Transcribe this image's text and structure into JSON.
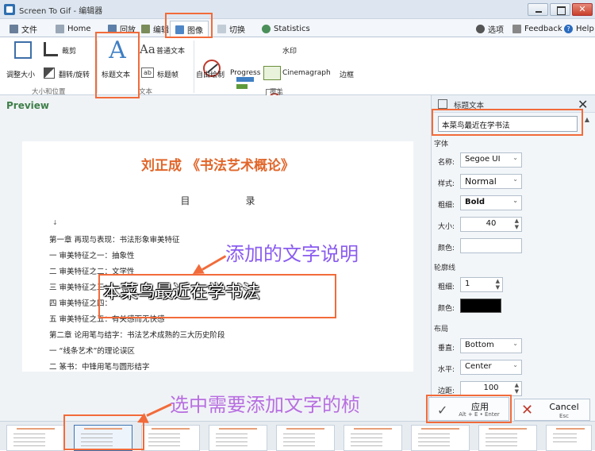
{
  "window": {
    "title": "Screen To Gif - 编辑器"
  },
  "tabs": {
    "file": "文件",
    "home": "Home",
    "playback": "回放",
    "edit": "编辑",
    "image": "图像",
    "transition": "切换",
    "statistics": "Statistics"
  },
  "topright": {
    "settings": "选项",
    "feedback": "Feedback",
    "help": "Help"
  },
  "ribbon": {
    "resize": "调整大小",
    "crop": "裁剪",
    "flip_rotate": "翻转/旋转",
    "group_size_position": "大小和位置",
    "title_text": "标题文本",
    "free_text": "普通文本",
    "title_frame": "标题帧",
    "group_text": "文本",
    "free_drawing": "自由绘制",
    "progress": "Progress",
    "watermark": "水印",
    "cinemagraph": "Cinemagraph",
    "border": "边框",
    "group_overlay": "覆盖"
  },
  "preview": {
    "label": "Preview"
  },
  "document": {
    "title": "刘正成 《书法艺术概论》",
    "toc": "目录",
    "lines": [
      "第一章 再现与表现：书法形象审美特征",
      "一 审美特征之一：抽象性",
      "二 审美特征之二：文学性",
      "三 审美特征之三：",
      "四 审美特征之四：",
      "五 审美特征之五：有关感而无快感",
      "第二章 论用笔与结字：书法艺术成熟的三大历史阶段",
      "一 “线条艺术”的理论误区",
      "二 篆书：中锋用笔与圆形结字"
    ],
    "overlay_caption": "本菜鸟最近在学书法"
  },
  "annotations": {
    "added_text_note": "添加的文字说明",
    "select_frame_note": "选中需要添加文字的桢"
  },
  "panel": {
    "title": "标题文本",
    "text_value": "本菜鸟最近在学书法",
    "font_section": "字体",
    "font_name_label": "名称:",
    "font_name_value": "Segoe UI",
    "style_label": "样式:",
    "style_value": "Normal",
    "weight_label": "粗细:",
    "weight_value": "Bold",
    "size_label": "大小:",
    "size_value": "40",
    "color_label": "颜色:",
    "outline_section": "轮廓线",
    "outline_thickness_label": "粗细:",
    "outline_thickness_value": "1",
    "outline_color_label": "颜色:",
    "layout_section": "布局",
    "vertical_label": "垂直:",
    "vertical_value": "Bottom",
    "horizontal_label": "水平:",
    "horizontal_value": "Center",
    "margin_label": "边距:",
    "margin_value": "100"
  },
  "buttons": {
    "apply": "应用",
    "apply_shortcut": "Alt + E • Enter",
    "cancel": "Cancel",
    "cancel_shortcut": "Esc"
  },
  "colors": {
    "accent_orange": "#f26b3a",
    "annotation_purple": "#8a5cf0",
    "doc_title_orange": "#e0662a",
    "preview_green": "#3f7f4a",
    "outline_color": "#000000"
  }
}
